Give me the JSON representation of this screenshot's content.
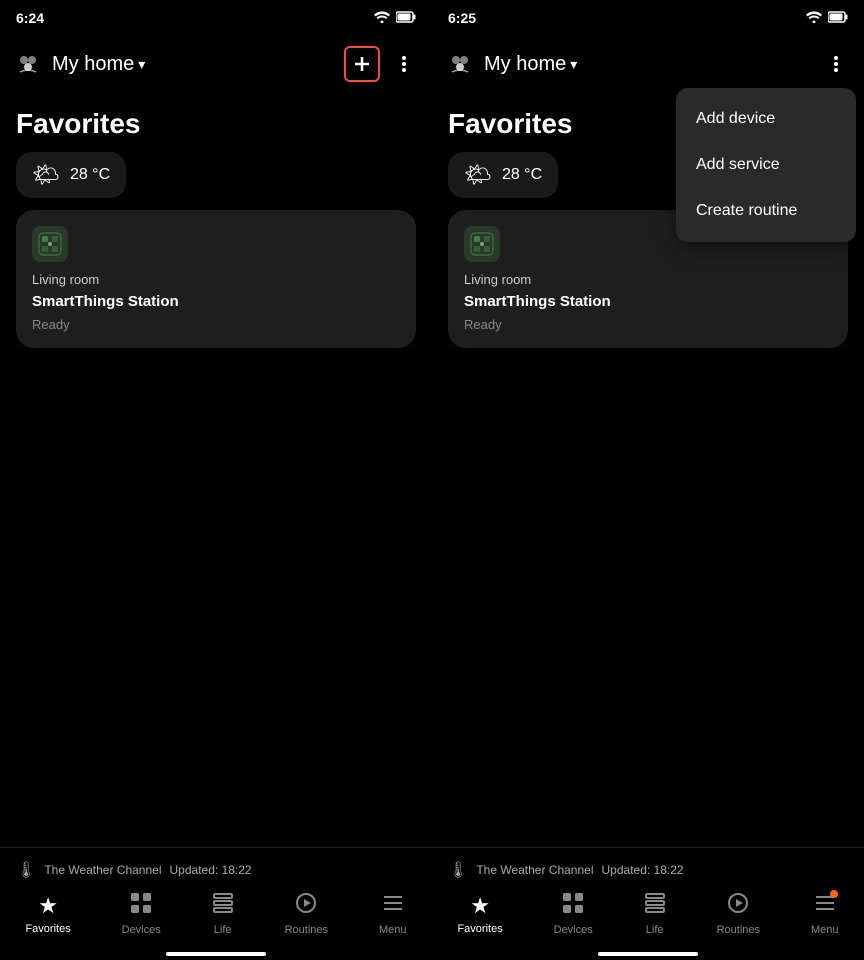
{
  "left_panel": {
    "status_bar": {
      "time": "6:24",
      "wifi_icon": "▼",
      "battery_icon": "▮"
    },
    "top_bar": {
      "home_label": "My home",
      "add_button_label": "+",
      "more_button_label": "⋮"
    },
    "section_title": "Favorites",
    "weather": {
      "icon": "🌤",
      "temp": "28 °C"
    },
    "device": {
      "location": "Living room",
      "name": "SmartThings Station",
      "status": "Ready"
    },
    "footer": {
      "channel_icon": "📺",
      "channel_name": "The Weather Channel",
      "updated_label": "Updated: 18:22"
    },
    "nav": {
      "items": [
        {
          "id": "favorites",
          "label": "Favorites",
          "icon": "★",
          "active": true,
          "badge": false
        },
        {
          "id": "devices",
          "label": "Devices",
          "icon": "⊞",
          "active": false,
          "badge": false
        },
        {
          "id": "life",
          "label": "Life",
          "icon": "☰",
          "active": false,
          "badge": false
        },
        {
          "id": "routines",
          "label": "Routines",
          "icon": "▷",
          "active": false,
          "badge": false
        },
        {
          "id": "menu",
          "label": "Menu",
          "icon": "≡",
          "active": false,
          "badge": false
        }
      ]
    }
  },
  "right_panel": {
    "status_bar": {
      "time": "6:25",
      "wifi_icon": "▼",
      "battery_icon": "▮"
    },
    "top_bar": {
      "home_label": "My home",
      "more_button_label": "⋮"
    },
    "section_title": "Favorites",
    "weather": {
      "icon": "🌤",
      "temp": "28 °C"
    },
    "device": {
      "location": "Living room",
      "name": "SmartThings Station",
      "status": "Ready"
    },
    "dropdown_menu": {
      "items": [
        {
          "id": "add-device",
          "label": "Add device"
        },
        {
          "id": "add-service",
          "label": "Add service"
        },
        {
          "id": "create-routine",
          "label": "Create routine"
        }
      ]
    },
    "footer": {
      "channel_icon": "📺",
      "channel_name": "The Weather Channel",
      "updated_label": "Updated: 18:22"
    },
    "nav": {
      "items": [
        {
          "id": "favorites",
          "label": "Favorites",
          "icon": "★",
          "active": true,
          "badge": false
        },
        {
          "id": "devices",
          "label": "Devices",
          "icon": "⊞",
          "active": false,
          "badge": false
        },
        {
          "id": "life",
          "label": "Life",
          "icon": "☰",
          "active": false,
          "badge": false
        },
        {
          "id": "routines",
          "label": "Routines",
          "icon": "▷",
          "active": false,
          "badge": false
        },
        {
          "id": "menu",
          "label": "Menu",
          "icon": "≡",
          "active": false,
          "badge": true
        }
      ]
    }
  }
}
